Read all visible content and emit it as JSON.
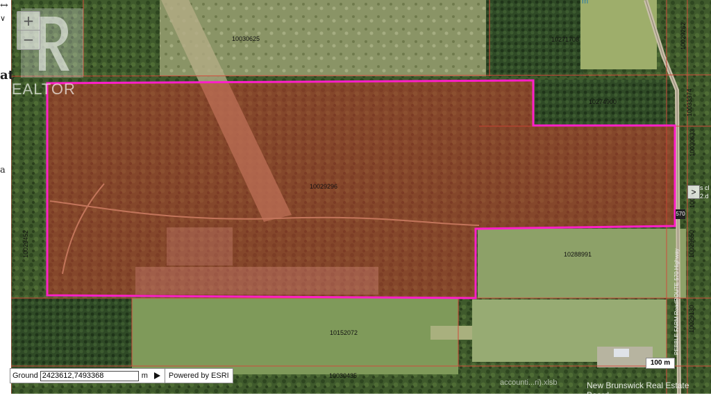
{
  "map": {
    "parcel_highlight_color": "#ff1fc8",
    "parcel_fill_color": "#c0382b",
    "boundary_color": "#d04a3a",
    "lots": [
      {
        "id": "lot-10030625",
        "label": "10030625"
      },
      {
        "id": "lot-10271708",
        "label": "10271708"
      },
      {
        "id": "lot-10274900",
        "label": "10274900"
      },
      {
        "id": "lot-10029296",
        "label": "10029296"
      },
      {
        "id": "lot-10288991",
        "label": "10288991"
      },
      {
        "id": "lot-10152072",
        "label": "10152072"
      },
      {
        "id": "lot-10030435",
        "label": "10030435"
      },
      {
        "id": "lot-10029452",
        "label": "10029452"
      },
      {
        "id": "lot-10029262",
        "label": "10029262"
      },
      {
        "id": "lot-10033374",
        "label": "10033374"
      },
      {
        "id": "lot-10030633",
        "label": "10030633"
      },
      {
        "id": "lot-1003",
        "label": "1003"
      },
      {
        "id": "lot-10029650",
        "label": "10029650"
      },
      {
        "id": "lot-10029130",
        "label": "10029130"
      }
    ],
    "road_labels": [
      "ROUTE 570 Highway",
      "PEBBLE FARM Road"
    ]
  },
  "controls": {
    "zoom_in": "+",
    "zoom_out": "−",
    "side_tab": ">",
    "top_unit": "m"
  },
  "coords": {
    "label": "Ground",
    "value": "2423612,7493368",
    "unit": "m",
    "powered_by": "Powered by ESRI"
  },
  "scale": {
    "label": "100 m"
  },
  "watermark": {
    "brand": "REALTOR",
    "board": "New Brunswick Real Estate Board",
    "file_hint": "accounti...ri).xlsb"
  },
  "page_fragments": {
    "top_left_glyph": "↔",
    "top_left_symbol": "∨",
    "at_text": "at",
    "a_text": "a",
    "right_edge_text": "s cl\n2.d",
    "marker_text": "570"
  }
}
